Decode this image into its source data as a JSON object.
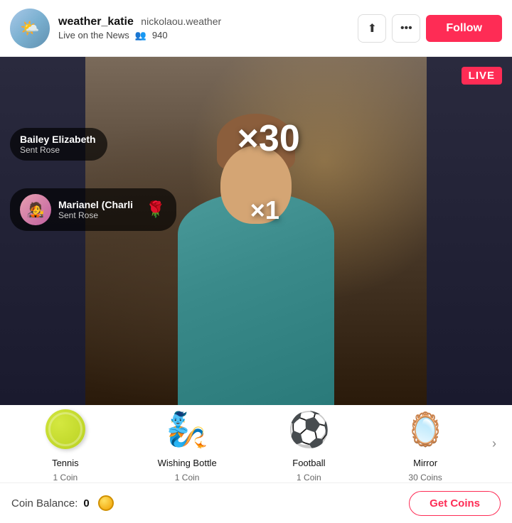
{
  "header": {
    "username": "weather_katie",
    "handle": "nickolaou.weather",
    "live_label": "Live on the News",
    "viewers_icon": "👥",
    "viewer_count": "940",
    "follow_label": "Follow"
  },
  "video": {
    "live_badge": "LIVE",
    "notifications": [
      {
        "name": "Bailey Elizabeth",
        "action": "Sent Rose"
      },
      {
        "name": "Marianel (Charli",
        "action": "Sent Rose"
      }
    ],
    "multiplier_big": "×30",
    "multiplier_small": "×1"
  },
  "gifts": {
    "items": [
      {
        "name": "Tennis",
        "cost": "1 Coin",
        "emoji": "🎾"
      },
      {
        "name": "Wishing Bottle",
        "cost": "1 Coin",
        "emoji": "🧞"
      },
      {
        "name": "Football",
        "cost": "1 Coin",
        "emoji": "⚽"
      },
      {
        "name": "Mirror",
        "cost": "30 Coins",
        "emoji": "🪞"
      }
    ],
    "arrow": "›"
  },
  "coin_bar": {
    "label": "Coin Balance:",
    "count": "0",
    "get_coins_label": "Get Coins"
  },
  "icons": {
    "share": "⇪",
    "more": "•••"
  }
}
